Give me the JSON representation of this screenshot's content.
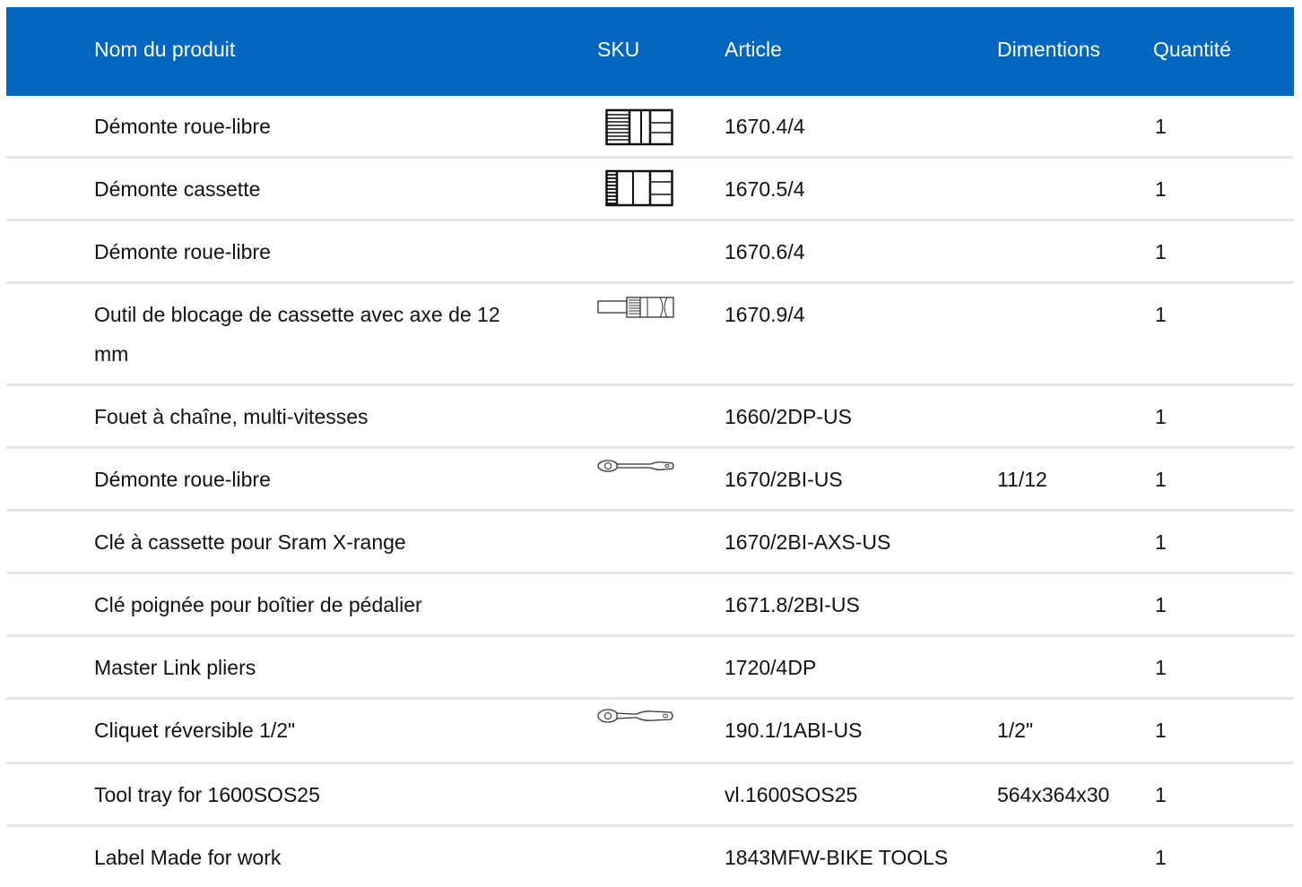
{
  "header": {
    "name": "Nom du produit",
    "sku": "SKU",
    "article": "Article",
    "dim": "Dimentions",
    "qty": "Quantité"
  },
  "rows": [
    {
      "name": "Démonte roue-libre",
      "article": "1670.4/4",
      "dim": "",
      "qty": "1",
      "icon": "socket-icon-fine-spline"
    },
    {
      "name": "Démonte cassette",
      "article": "1670.5/4",
      "dim": "",
      "qty": "1",
      "icon": "socket-icon-cassette"
    },
    {
      "name": "Démonte roue-libre",
      "article": "1670.6/4",
      "dim": "",
      "qty": "1",
      "icon": ""
    },
    {
      "name": "Outil de blocage de cassette avec axe de 12 mm",
      "article": "1670.9/4",
      "dim": "",
      "qty": "1",
      "icon": "socket-with-axle-icon"
    },
    {
      "name": "Fouet à chaîne, multi-vitesses",
      "article": "1660/2DP-US",
      "dim": "",
      "qty": "1",
      "icon": ""
    },
    {
      "name": "Démonte roue-libre",
      "article": "1670/2BI-US",
      "dim": "11/12",
      "qty": "1",
      "icon": "wrench-icon"
    },
    {
      "name": "Clé à cassette pour Sram X-range",
      "article": "1670/2BI-AXS-US",
      "dim": "",
      "qty": "1",
      "icon": ""
    },
    {
      "name": "Clé poignée pour boîtier de pédalier",
      "article": "1671.8/2BI-US",
      "dim": "",
      "qty": "1",
      "icon": ""
    },
    {
      "name": "Master Link pliers",
      "article": "1720/4DP",
      "dim": "",
      "qty": "1",
      "icon": ""
    },
    {
      "name": "Cliquet réversible 1/2\"",
      "article": "190.1/1ABI-US",
      "dim": "1/2\"",
      "qty": "1",
      "icon": "ratchet-icon"
    },
    {
      "name": "Tool tray for 1600SOS25",
      "article": "vl.1600SOS25",
      "dim": "564x364x30",
      "qty": "1",
      "icon": ""
    },
    {
      "name": "Label Made for work",
      "article": "1843MFW-BIKE TOOLS",
      "dim": "",
      "qty": "1",
      "icon": ""
    }
  ]
}
